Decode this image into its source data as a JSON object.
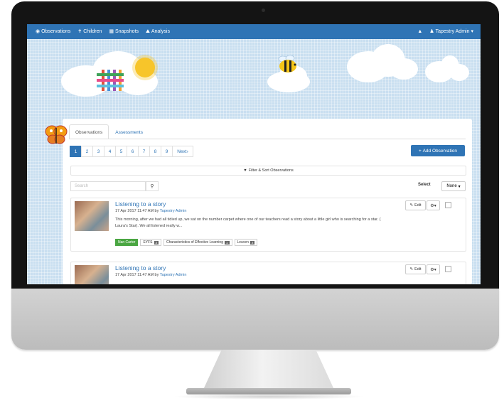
{
  "navbar": {
    "items": [
      {
        "icon": "eye-icon",
        "glyph": "◉",
        "label": "Observations"
      },
      {
        "icon": "child-icon",
        "glyph": "✝",
        "label": "Children"
      },
      {
        "icon": "snapshot-icon",
        "glyph": "▦",
        "label": "Snapshots"
      },
      {
        "icon": "chart-icon",
        "glyph": "⛰",
        "label": "Analysis"
      }
    ],
    "bell_glyph": "▲",
    "user_glyph": "♟",
    "user_label": "Tapestry Admin",
    "user_caret": "▾"
  },
  "tabs": [
    "Observations",
    "Assessments"
  ],
  "pagination": {
    "pages": [
      "1",
      "2",
      "3",
      "4",
      "5",
      "6",
      "7",
      "8",
      "9"
    ],
    "active": "1",
    "next_label": "Next",
    "next_glyph": "›"
  },
  "add_button": {
    "glyph": "+",
    "label": "Add Observation"
  },
  "filter": {
    "glyph": "▼",
    "label": "Filter & Sort Observations"
  },
  "search": {
    "placeholder": "Search",
    "glyph": "⚲"
  },
  "select": {
    "label": "Select",
    "value": "None",
    "caret": "▾"
  },
  "observations": [
    {
      "title": "Listening to a story",
      "date": "17 Apr 2017 11:47 AM by ",
      "author": "Tapestry Admin",
      "body": "This morning, after we had all tidied up, we sat on the number carpet where one of our teachers read a story about a little girl who is searching for a star. ( Laura's Star). We all listened really w...",
      "tags": [
        {
          "label": "Nan Carter",
          "count": ""
        },
        {
          "label": "EYFS",
          "count": "3"
        },
        {
          "label": "Characteristics of Effective Learning",
          "count": "1"
        },
        {
          "label": "Leuven",
          "count": "2"
        }
      ],
      "edit_label": "Edit",
      "gear_glyph": "⚙",
      "caret_glyph": "▾",
      "pencil_glyph": "✎"
    },
    {
      "title": "Listening to a story",
      "date": "17 Apr 2017 11:47 AM by ",
      "author": "Tapestry Admin",
      "edit_label": "Edit",
      "gear_glyph": "⚙",
      "caret_glyph": "▾",
      "pencil_glyph": "✎"
    }
  ],
  "colors": {
    "brand_blue": "#2f74b5",
    "tag_green": "#4aa642",
    "sky": "#c9dff0"
  }
}
